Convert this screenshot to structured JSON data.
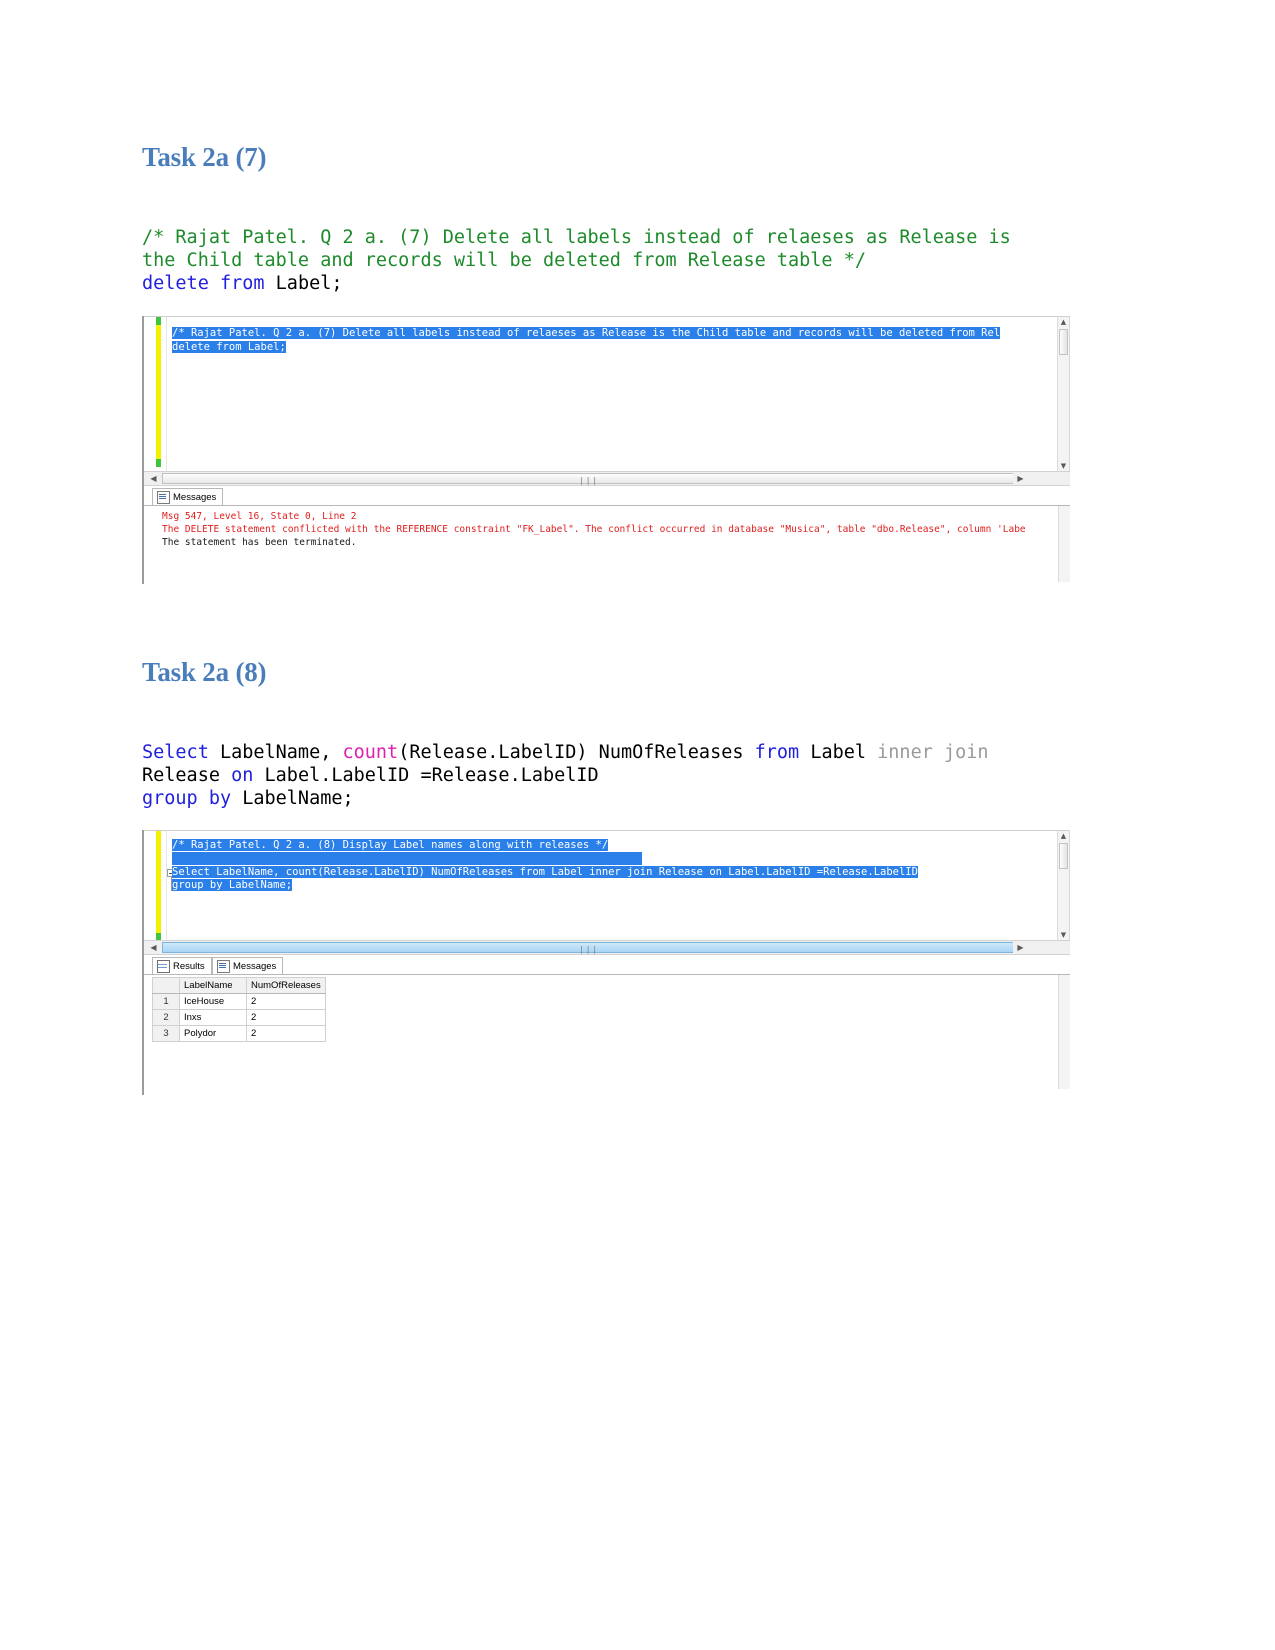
{
  "document": {
    "headings": {
      "task7": "Task 2a (7)",
      "task8": "Task 2a (8)"
    },
    "code7": {
      "comment_line1": "/* Rajat Patel. Q 2 a. (7) Delete all labels instead of relaeses as Release is",
      "comment_line2": "the Child table and records will be deleted from Release table */",
      "kw_delete": "delete",
      "kw_from": "from",
      "ident_label": "Label",
      "semicolon": ";"
    },
    "code8": {
      "kw_select": "Select",
      "ident_labelname": " LabelName",
      "comma": ",",
      "fn_count": " count",
      "args": "(Release.LabelID)",
      "alias": " NumOfReleases ",
      "kw_from": "from",
      "tbl_label": " Label ",
      "kw_innerjoin": "inner join",
      "line2_a": "Release ",
      "kw_on": "on",
      "line2_b": " Label.LabelID =Release.LabelID",
      "kw_groupby": "group by",
      "line3_b": " LabelName",
      "semicolon": ";"
    }
  },
  "screenshot1": {
    "editor": {
      "line1": "/* Rajat Patel. Q 2 a. (7) Delete all labels instead of relaeses as Release is the Child table and records will be deleted from Rel",
      "line2": "delete from Label;"
    },
    "tabs": [
      {
        "label": "Messages",
        "icon": "messages-icon",
        "active": true
      }
    ],
    "messages": [
      "Msg 547, Level 16, State 0, Line 2",
      "The DELETE statement conflicted with the REFERENCE constraint \"FK_Label\". The conflict occurred in database \"Musica\", table \"dbo.Release\", column 'Labe",
      "The statement has been terminated."
    ],
    "scrollbar": {
      "left_arrow": "◀",
      "right_arrow": "▶",
      "grip": "❘❘❘",
      "up_arrow": "▲",
      "down_arrow": "▼"
    }
  },
  "screenshot2": {
    "editor": {
      "line1": "/* Rajat Patel. Q 2 a. (8) Display Label names along with releases */",
      "line2": "",
      "line3": "Select LabelName, count(Release.LabelID) NumOfReleases from Label inner join Release on Label.LabelID =Release.LabelID",
      "line4": "group by LabelName;"
    },
    "tabs": [
      {
        "label": "Results",
        "icon": "results-grid-icon",
        "active": true
      },
      {
        "label": "Messages",
        "icon": "messages-icon",
        "active": false
      }
    ],
    "results": {
      "columns": [
        "",
        "LabelName",
        "NumOfReleases"
      ],
      "rows": [
        {
          "num": "1",
          "LabelName": "IceHouse",
          "NumOfReleases": "2"
        },
        {
          "num": "2",
          "LabelName": "Inxs",
          "NumOfReleases": "2"
        },
        {
          "num": "3",
          "LabelName": "Polydor",
          "NumOfReleases": "2"
        }
      ]
    },
    "scrollbar": {
      "left_arrow": "◀",
      "right_arrow": "▶",
      "grip": "❘❘❘",
      "up_arrow": "▲",
      "down_arrow": "▼"
    }
  },
  "colors": {
    "heading": "#4a7ebb",
    "comment": "#1d8b2b",
    "keyword": "#2020dd",
    "function": "#e020b0",
    "selection": "#2a7fe8",
    "error": "#e02020"
  }
}
